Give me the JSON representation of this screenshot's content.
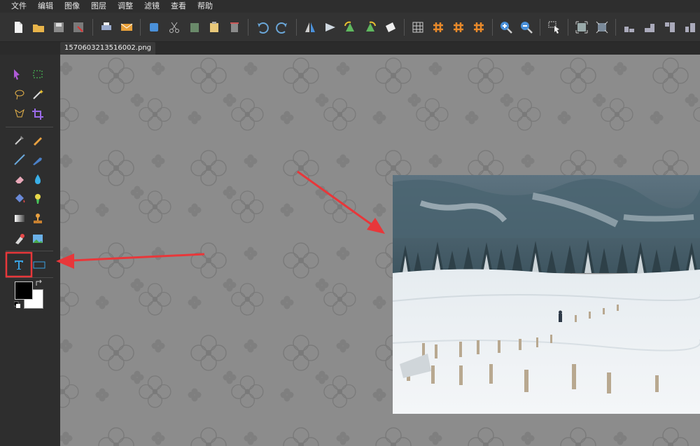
{
  "menu": [
    "文件",
    "编辑",
    "图像",
    "图层",
    "调整",
    "滤镜",
    "查看",
    "帮助"
  ],
  "document_tab": {
    "filename": "1570603213516002.png"
  },
  "toolbar_icons": [
    "new-file-icon",
    "open-folder-icon",
    "save-icon",
    "save-as-icon",
    "print-icon",
    "email-icon",
    "copy-layer-icon",
    "cut-icon",
    "paste-icon",
    "clipboard-icon",
    "delete-icon",
    "undo-icon",
    "redo-icon",
    "flip-horizontal-icon",
    "flip-vertical-icon",
    "rotate-left-icon",
    "rotate-right-icon",
    "rotate-free-icon",
    "grid-icon",
    "hash-grid-icon",
    "hash-grid-2-icon",
    "hash-grid-3-icon",
    "zoom-in-icon",
    "zoom-out-icon",
    "select-cursor-icon",
    "crop-fit-icon",
    "resize-icon",
    "align-bottom-icon",
    "align-top-icon",
    "align-right-icon",
    "align-left-icon"
  ],
  "tools": [
    "move-tool",
    "rect-select-tool",
    "lasso-tool",
    "magic-wand-tool",
    "polygon-lasso-tool",
    "crop-tool",
    "eyedropper-tool",
    "pencil-tool",
    "line-tool",
    "brush-tool",
    "eraser-tool",
    "blur-tool",
    "fill-tool",
    "sharpen-tool",
    "gradient-tool",
    "clone-stamp-tool",
    "smudge-tool",
    "picture-tool",
    "text-tool",
    "shape-tool"
  ],
  "colors": {
    "accent_red": "#e8373a",
    "text_tool_blue": "#3aa0e0",
    "foreground": "#000000",
    "background": "#ffffff"
  }
}
